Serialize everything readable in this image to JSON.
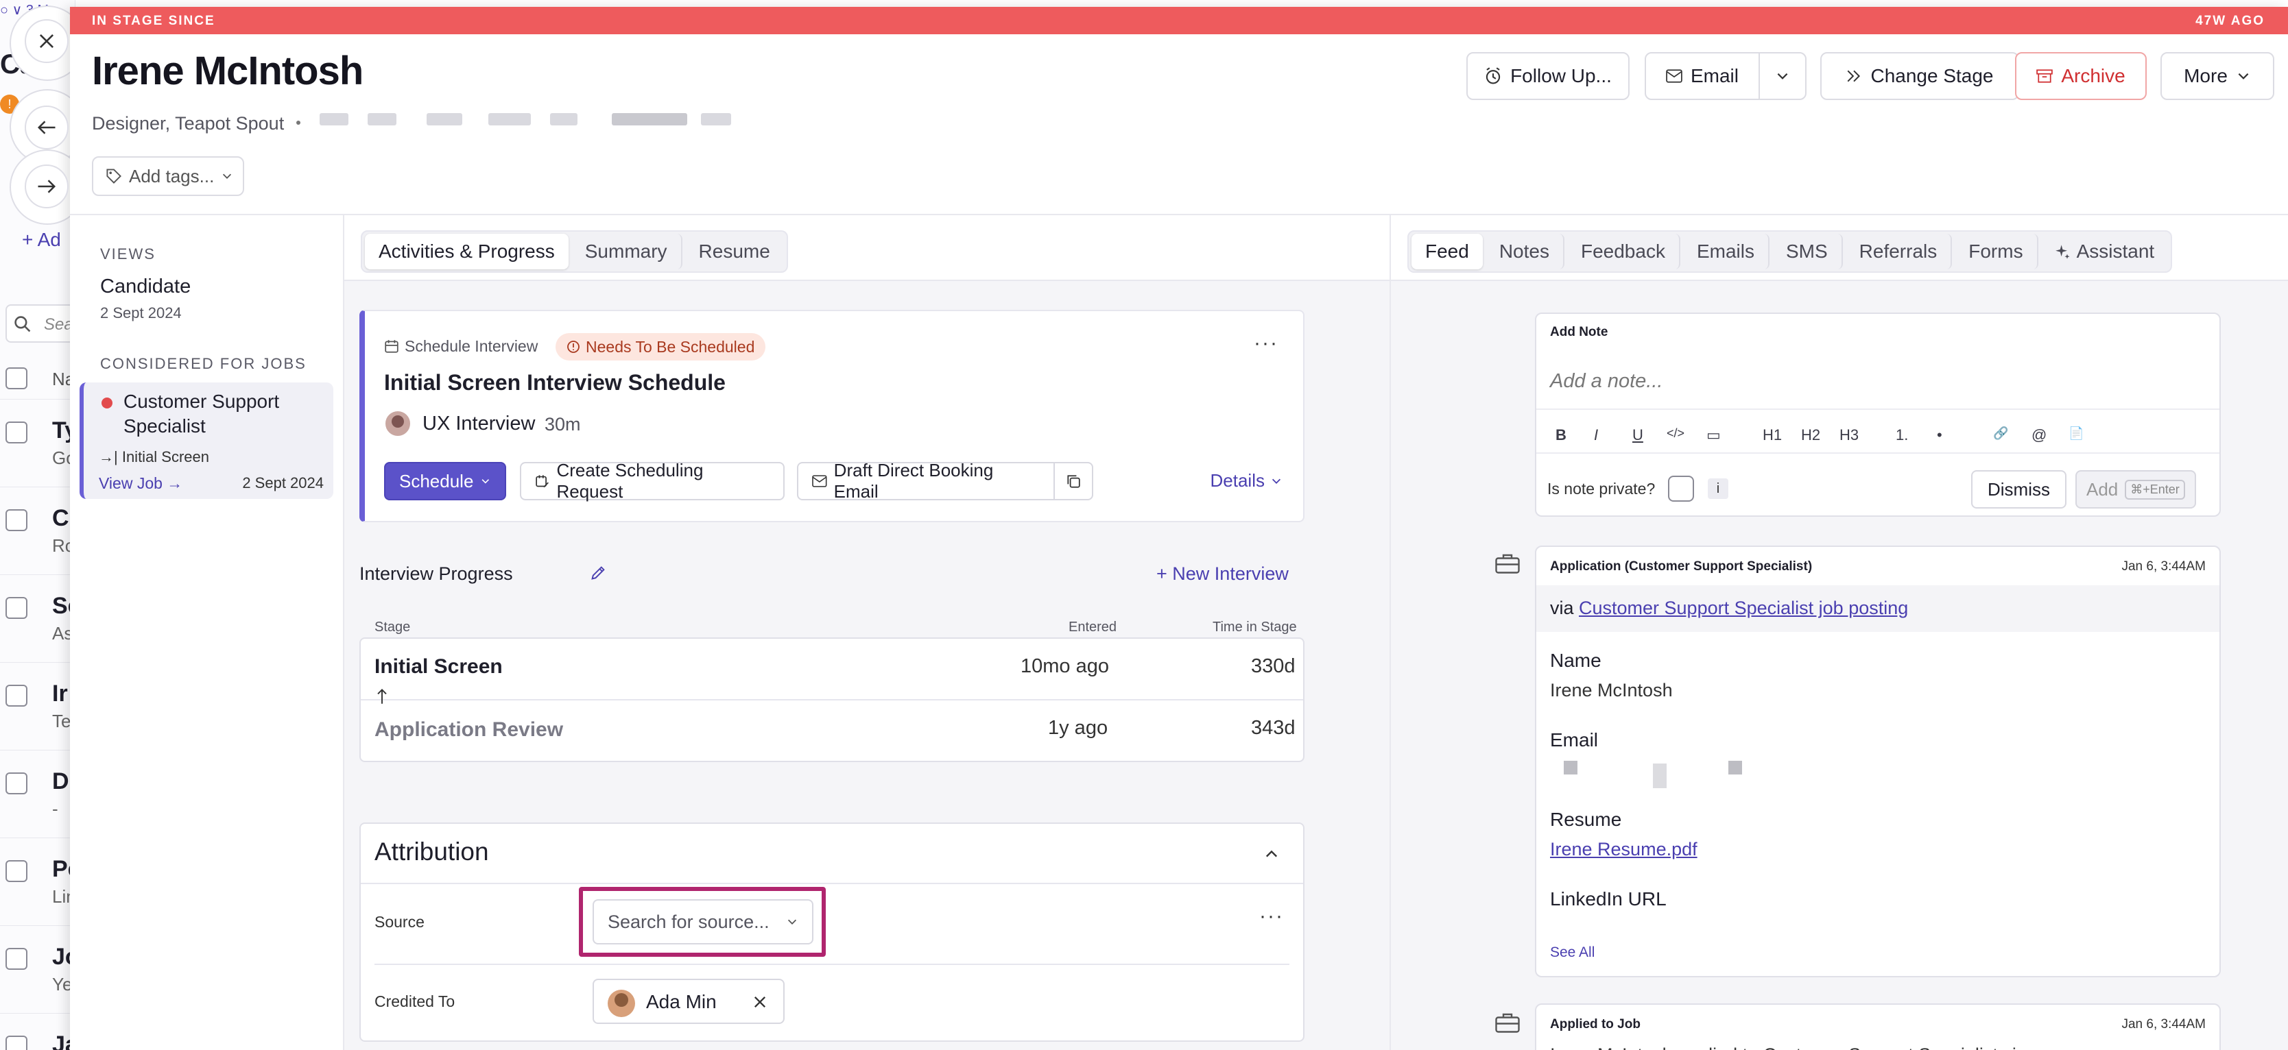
{
  "background_list": {
    "title_fragment": "Cand",
    "rows": [
      {
        "name": "Ty",
        "sub": "Go"
      },
      {
        "name": "C",
        "sub": "Ro"
      },
      {
        "name": "Se",
        "sub": "As"
      },
      {
        "name": "Ir",
        "sub": "Te"
      },
      {
        "name": "D",
        "sub": "-"
      },
      {
        "name": "Pe",
        "sub": "Lin"
      },
      {
        "name": "Jo",
        "sub": "Ye"
      },
      {
        "name": "Ja",
        "sub": ""
      }
    ],
    "add_label": "+ Ad",
    "search_placeholder": "Sea",
    "name_col": "Na",
    "badge": "!"
  },
  "stage_bar": {
    "label": "IN STAGE SINCE",
    "age": "47W AGO"
  },
  "candidate": {
    "name": "Irene McIntosh",
    "title": "Designer, Teapot Spout",
    "tags_label": "Add tags..."
  },
  "header_buttons": {
    "follow_up": "Follow Up...",
    "email": "Email",
    "change_stage": "Change Stage",
    "archive": "Archive",
    "more": "More"
  },
  "sidebar": {
    "views_heading": "VIEWS",
    "view_name": "Candidate",
    "view_date": "2 Sept 2024",
    "jobs_heading": "CONSIDERED FOR JOBS",
    "job_title_1": "Customer Support",
    "job_title_2": "Specialist",
    "job_stage": "Initial Screen",
    "view_job": "View Job",
    "job_date": "2 Sept 2024"
  },
  "middle_tabs": [
    "Activities & Progress",
    "Summary",
    "Resume"
  ],
  "schedule": {
    "label": "Schedule Interview",
    "status": "Needs To Be Scheduled",
    "title": "Initial Screen Interview Schedule",
    "interview_name": "UX Interview",
    "duration": "30m",
    "schedule_btn": "Schedule",
    "create_request_btn": "Create Scheduling Request",
    "draft_email_btn": "Draft Direct Booking Email",
    "details_link": "Details"
  },
  "progress": {
    "title": "Interview Progress",
    "new_interview": "New Interview",
    "col_stage": "Stage",
    "col_entered": "Entered",
    "col_time": "Time in Stage",
    "rows": [
      {
        "stage": "Initial Screen",
        "entered": "10mo ago",
        "time": "330d"
      },
      {
        "stage": "Application Review",
        "entered": "1y ago",
        "time": "343d"
      }
    ]
  },
  "attribution": {
    "title": "Attribution",
    "source_label": "Source",
    "source_placeholder": "Search for source...",
    "credited_label": "Credited To",
    "credited_name": "Ada Min"
  },
  "right_tabs": [
    "Feed",
    "Notes",
    "Feedback",
    "Emails",
    "SMS",
    "Referrals",
    "Forms",
    "Assistant"
  ],
  "note": {
    "heading": "Add Note",
    "placeholder": "Add a note...",
    "toolbar": [
      "B",
      "I",
      "U",
      "</>",
      "▭",
      "H1",
      "H2",
      "H3",
      "1.",
      "•",
      "🔗",
      "@",
      "📄"
    ],
    "private_label": "Is note private?",
    "dismiss": "Dismiss",
    "add": "Add",
    "shortcut": "⌘+Enter"
  },
  "application": {
    "title": "Application (Customer Support Specialist)",
    "time": "Jan 6, 3:44AM",
    "via_prefix": "via",
    "via_link": "Customer Support Specialist job posting",
    "name_label": "Name",
    "name_value": "Irene McIntosh",
    "email_label": "Email",
    "resume_label": "Resume",
    "resume_link": "Irene Resume.pdf",
    "linkedin_label": "LinkedIn URL",
    "see_all": "See All"
  },
  "applied": {
    "title": "Applied to Job",
    "time": "Jan 6, 3:44AM",
    "text": "Irene McIntosh applied to Customer Support Specialist via an"
  },
  "colors": {
    "accent": "#5b52c9",
    "stage_bar": "#ee5b5d",
    "highlight": "#b0256e"
  }
}
